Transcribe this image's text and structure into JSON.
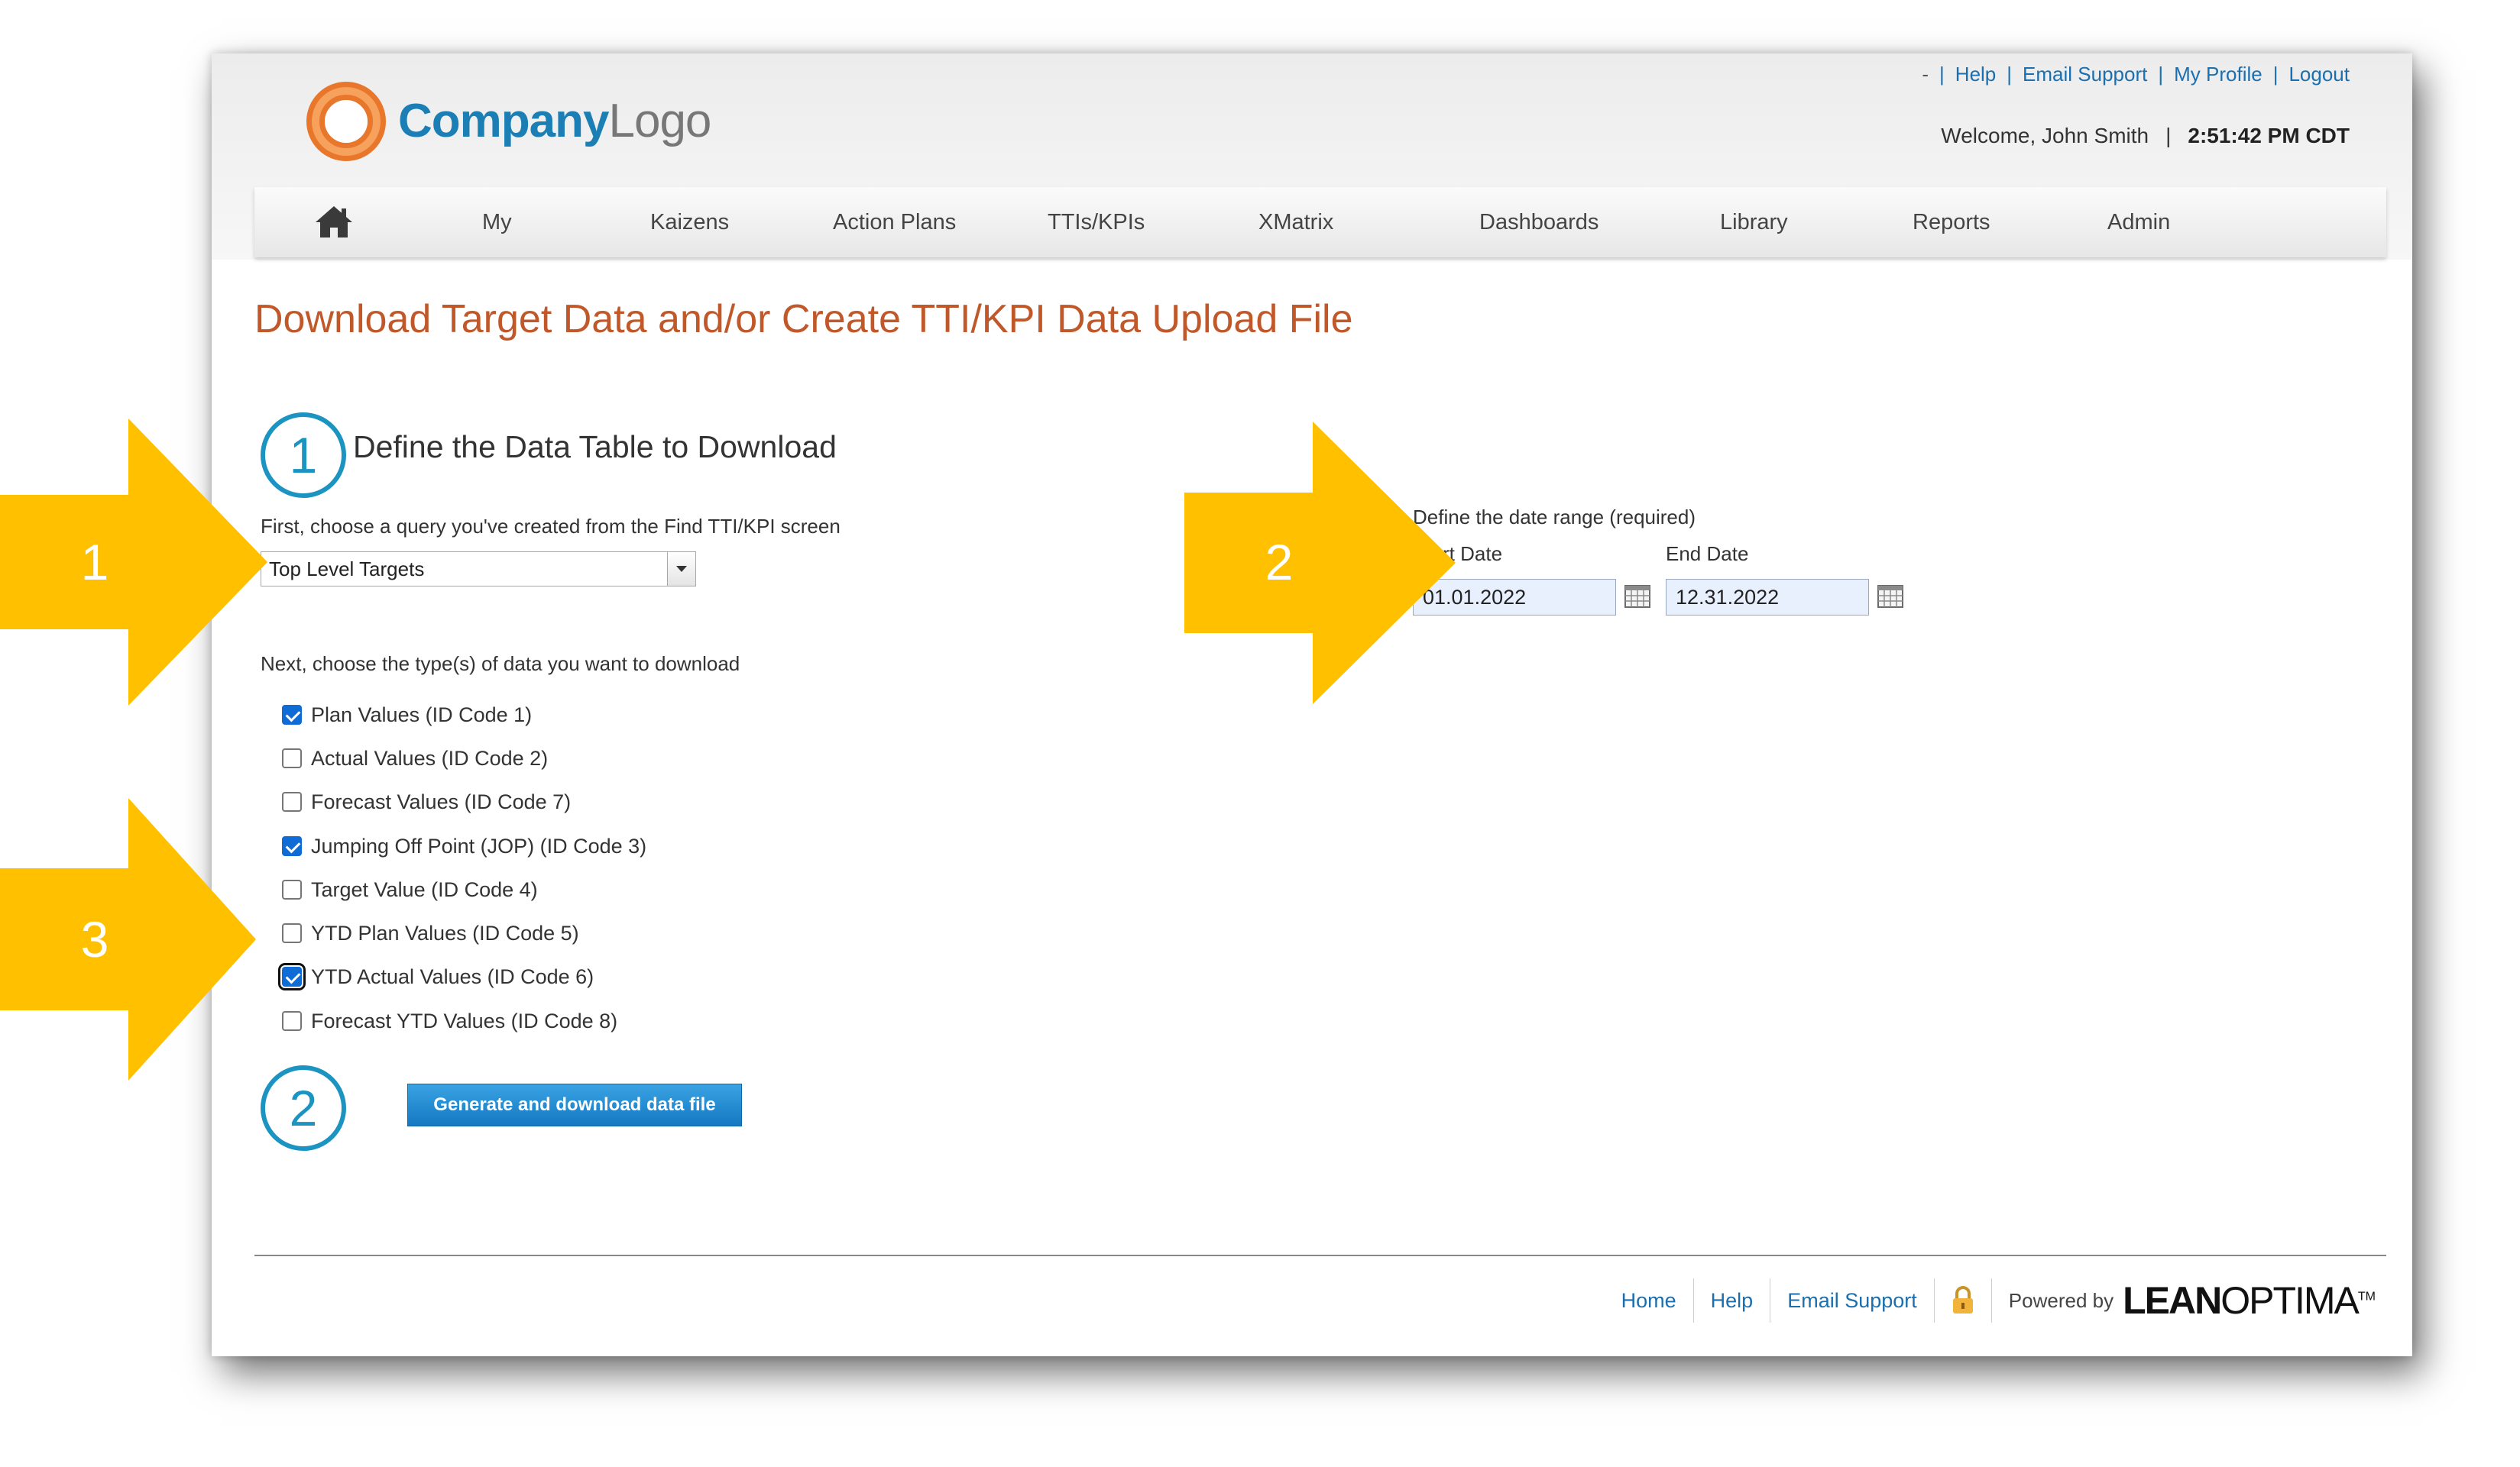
{
  "header": {
    "logo": {
      "company": "Company",
      "logo": "Logo"
    },
    "top_links": {
      "dash": "-",
      "help": "Help",
      "email_support": "Email Support",
      "my_profile": "My Profile",
      "logout": "Logout"
    },
    "welcome": "Welcome, John Smith",
    "welcome_separator": "|",
    "time": "2:51:42 PM CDT"
  },
  "nav": {
    "home_icon": "home-icon",
    "items": [
      "My",
      "Kaizens",
      "Action Plans",
      "TTIs/KPIs",
      "XMatrix",
      "Dashboards",
      "Library",
      "Reports",
      "Admin"
    ]
  },
  "page_title": "Download Target Data and/or Create TTI/KPI Data Upload File",
  "step1": {
    "number": "1",
    "title": "Define the Data Table to Download",
    "query_label": "First, choose a query you've created from the Find TTI/KPI screen",
    "query_selected": "Top Level Targets",
    "types_label": "Next, choose the type(s) of data you want to download",
    "options": [
      {
        "label": "Plan Values (ID Code 1)",
        "checked": true
      },
      {
        "label": "Actual Values (ID Code 2)",
        "checked": false
      },
      {
        "label": "Forecast Values (ID Code 7)",
        "checked": false
      },
      {
        "label": "Jumping Off Point (JOP) (ID Code 3)",
        "checked": true
      },
      {
        "label": "Target Value (ID Code 4)",
        "checked": false
      },
      {
        "label": "YTD Plan Values (ID Code 5)",
        "checked": false
      },
      {
        "label": "YTD Actual Values (ID Code 6)",
        "checked": true
      },
      {
        "label": "Forecast YTD Values (ID Code 8)",
        "checked": false
      }
    ]
  },
  "date_range": {
    "label": "Define the date range (required)",
    "start_label": "Start Date",
    "end_label": "End Date",
    "start_value": "01.01.2022",
    "end_value": "12.31.2022"
  },
  "step2": {
    "number": "2",
    "button_label": "Generate and download data file"
  },
  "footer": {
    "home": "Home",
    "help": "Help",
    "email_support": "Email Support",
    "lock_icon": "lock-icon",
    "powered_by": "Powered by",
    "brand_bold": "LEAN",
    "brand_light": "OPTIMA",
    "brand_tm": "TM"
  },
  "callouts": {
    "arrow1": "1",
    "arrow2": "2",
    "arrow3": "3",
    "color": "#ffc000"
  },
  "colors": {
    "title": "#c0582a",
    "link": "#1b6faf",
    "accent": "#1b94c2",
    "button": "#1478c2"
  }
}
